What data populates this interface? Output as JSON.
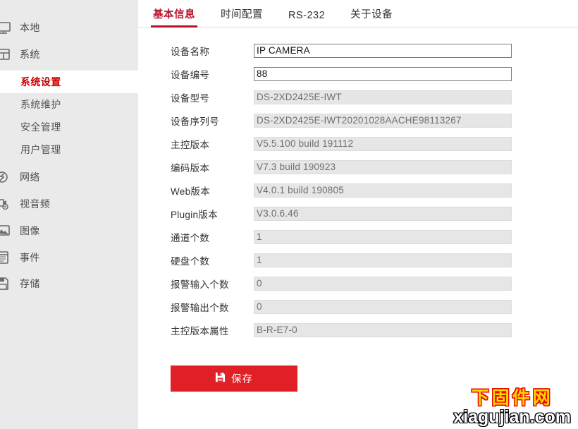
{
  "sidebar": {
    "items": [
      {
        "label": "本地",
        "icon": "monitor-icon",
        "type": "top"
      },
      {
        "label": "系统",
        "icon": "system-icon",
        "type": "top"
      },
      {
        "label": "系统设置",
        "icon": "",
        "type": "sub",
        "active": true
      },
      {
        "label": "系统维护",
        "icon": "",
        "type": "sub",
        "active": false
      },
      {
        "label": "安全管理",
        "icon": "",
        "type": "sub",
        "active": false
      },
      {
        "label": "用户管理",
        "icon": "",
        "type": "sub",
        "active": false
      },
      {
        "label": "网络",
        "icon": "network-icon",
        "type": "top"
      },
      {
        "label": "视音频",
        "icon": "video-audio-icon",
        "type": "top"
      },
      {
        "label": "图像",
        "icon": "image-icon",
        "type": "top"
      },
      {
        "label": "事件",
        "icon": "event-icon",
        "type": "top"
      },
      {
        "label": "存储",
        "icon": "storage-icon",
        "type": "top"
      }
    ]
  },
  "tabs": [
    {
      "label": "基本信息",
      "active": true
    },
    {
      "label": "时间配置",
      "active": false
    },
    {
      "label": "RS-232",
      "active": false
    },
    {
      "label": "关于设备",
      "active": false
    }
  ],
  "form": {
    "rows": [
      {
        "label": "设备名称",
        "value": "IP CAMERA",
        "readonly": false
      },
      {
        "label": "设备编号",
        "value": "88",
        "readonly": false
      },
      {
        "label": "设备型号",
        "value": "DS-2XD2425E-IWT",
        "readonly": true
      },
      {
        "label": "设备序列号",
        "value": "DS-2XD2425E-IWT20201028AACHE98113267",
        "readonly": true
      },
      {
        "label": "主控版本",
        "value": "V5.5.100 build 191112",
        "readonly": true
      },
      {
        "label": "编码版本",
        "value": "V7.3 build 190923",
        "readonly": true
      },
      {
        "label": "Web版本",
        "value": "V4.0.1 build 190805",
        "readonly": true
      },
      {
        "label": "Plugin版本",
        "value": "V3.0.6.46",
        "readonly": true
      },
      {
        "label": "通道个数",
        "value": "1",
        "readonly": true
      },
      {
        "label": "硬盘个数",
        "value": "1",
        "readonly": true
      },
      {
        "label": "报警输入个数",
        "value": "0",
        "readonly": true
      },
      {
        "label": "报警输出个数",
        "value": "0",
        "readonly": true
      },
      {
        "label": "主控版本属性",
        "value": "B-R-E7-0",
        "readonly": true
      }
    ]
  },
  "actions": {
    "save_label": "保存",
    "save_icon": "floppy-disk-icon"
  },
  "watermark": {
    "cn": "下固件网",
    "en": "xiagujian.com"
  },
  "colors": {
    "accent_red": "#b8122a",
    "button_red": "#e01f26",
    "sidebar_bg": "#eaeaea",
    "readonly_bg": "#e6e6e6",
    "watermark_yellow": "#ffd400",
    "watermark_stroke_red": "#ee0000"
  }
}
